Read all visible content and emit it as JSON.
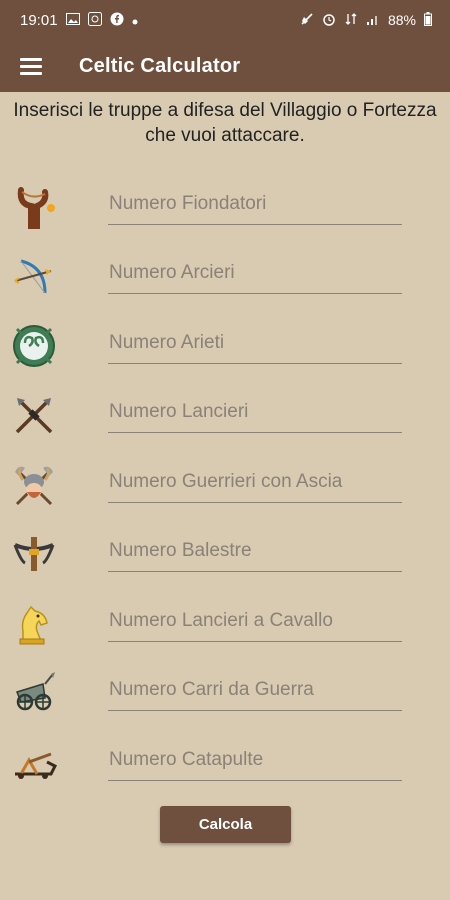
{
  "statusbar": {
    "time": "19:01",
    "battery": "88%",
    "left_icons": [
      "image-icon",
      "sync-icon",
      "facebook-icon",
      "dot-icon"
    ],
    "right_icons": [
      "mute-icon",
      "alarm-icon",
      "data-icon",
      "signal-icon",
      "battery-icon"
    ]
  },
  "appbar": {
    "title": "Celtic Calculator",
    "menu_icon": "hamburger-menu-icon"
  },
  "intro": "Inserisci le truppe a difesa del Villaggio o Fortezza che vuoi attaccare.",
  "fields": [
    {
      "placeholder": "Numero Fiondatori",
      "value": "",
      "icon": "slingshot-icon"
    },
    {
      "placeholder": "Numero Arcieri",
      "value": "",
      "icon": "bow-icon"
    },
    {
      "placeholder": "Numero Arieti",
      "value": "",
      "icon": "ram-icon"
    },
    {
      "placeholder": "Numero Lancieri",
      "value": "",
      "icon": "crossed-spears-icon"
    },
    {
      "placeholder": "Numero Guerrieri con Ascia",
      "value": "",
      "icon": "viking-axe-icon"
    },
    {
      "placeholder": "Numero Balestre",
      "value": "",
      "icon": "crossbow-icon"
    },
    {
      "placeholder": "Numero Lancieri a Cavallo",
      "value": "",
      "icon": "knight-horse-icon"
    },
    {
      "placeholder": "Numero Carri da Guerra",
      "value": "",
      "icon": "war-chariot-icon"
    },
    {
      "placeholder": "Numero Catapulte",
      "value": "",
      "icon": "catapult-icon"
    }
  ],
  "calc_button": "Calcola",
  "colors": {
    "primary": "#6f4f3d",
    "background": "#d9cbb2",
    "underline": "#8b8377"
  }
}
